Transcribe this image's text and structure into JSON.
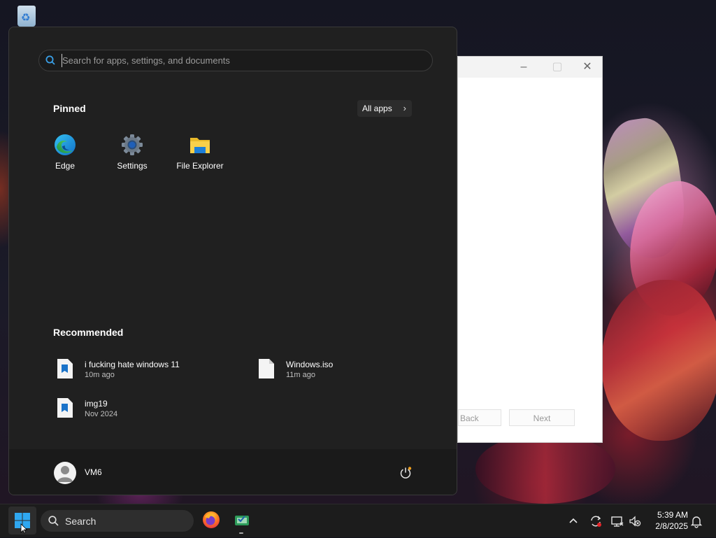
{
  "desktop": {
    "recycle_bin_icon": "recycle-bin-icon"
  },
  "dialog": {
    "back_label": "Back",
    "next_label": "Next"
  },
  "start_menu": {
    "search_placeholder": "Search for apps, settings, and documents",
    "pinned_title": "Pinned",
    "all_apps_label": "All apps",
    "pinned": [
      {
        "label": "Edge",
        "icon": "edge-icon"
      },
      {
        "label": "Settings",
        "icon": "settings-gear-icon"
      },
      {
        "label": "File Explorer",
        "icon": "folder-icon"
      }
    ],
    "recommended_title": "Recommended",
    "recommended": [
      {
        "name": "i fucking hate windows 11",
        "time": "10m ago",
        "icon": "image-file-icon"
      },
      {
        "name": "Windows.iso",
        "time": "11m ago",
        "icon": "file-icon"
      },
      {
        "name": "img19",
        "time": "Nov 2024",
        "icon": "image-file-icon"
      }
    ],
    "user_name": "VM6"
  },
  "taskbar": {
    "search_label": "Search",
    "apps": [
      "firefox-icon",
      "spreadsheet-app-icon"
    ],
    "clock_time": "5:39 AM",
    "clock_date": "2/8/2025"
  },
  "colors": {
    "start_bg": "#202020",
    "taskbar_bg": "#1c1c1c",
    "accent": "#0078d4"
  }
}
